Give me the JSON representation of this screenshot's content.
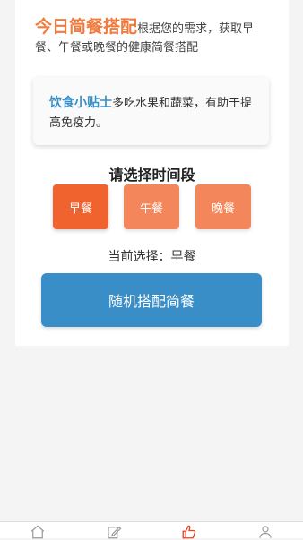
{
  "header": {
    "title": "今日简餐搭配",
    "description": "根据您的需求，获取早餐、午餐或晚餐的健康简餐搭配"
  },
  "tip": {
    "title": "饮食小贴士",
    "text": "多吃水果和蔬菜，有助于提高免疫力。"
  },
  "meal_section": {
    "title": "请选择时间段",
    "options": [
      "早餐",
      "午餐",
      "晚餐"
    ],
    "selected": "早餐"
  },
  "current_selection": {
    "text": "当前选择：早餐"
  },
  "random_button": {
    "label": "随机搭配简餐"
  },
  "bottom_nav": {
    "items": [
      "home-icon",
      "edit-icon",
      "thumbs-up-icon",
      "profile-icon"
    ],
    "active": "thumbs-up-icon"
  },
  "colors": {
    "accent_orange": "#f07b3e",
    "button_selected": "#f0632f",
    "button_normal": "#f3865a",
    "accent_blue": "#3a8ec8",
    "nav_active": "#e0452b",
    "nav_inactive": "#999999"
  }
}
